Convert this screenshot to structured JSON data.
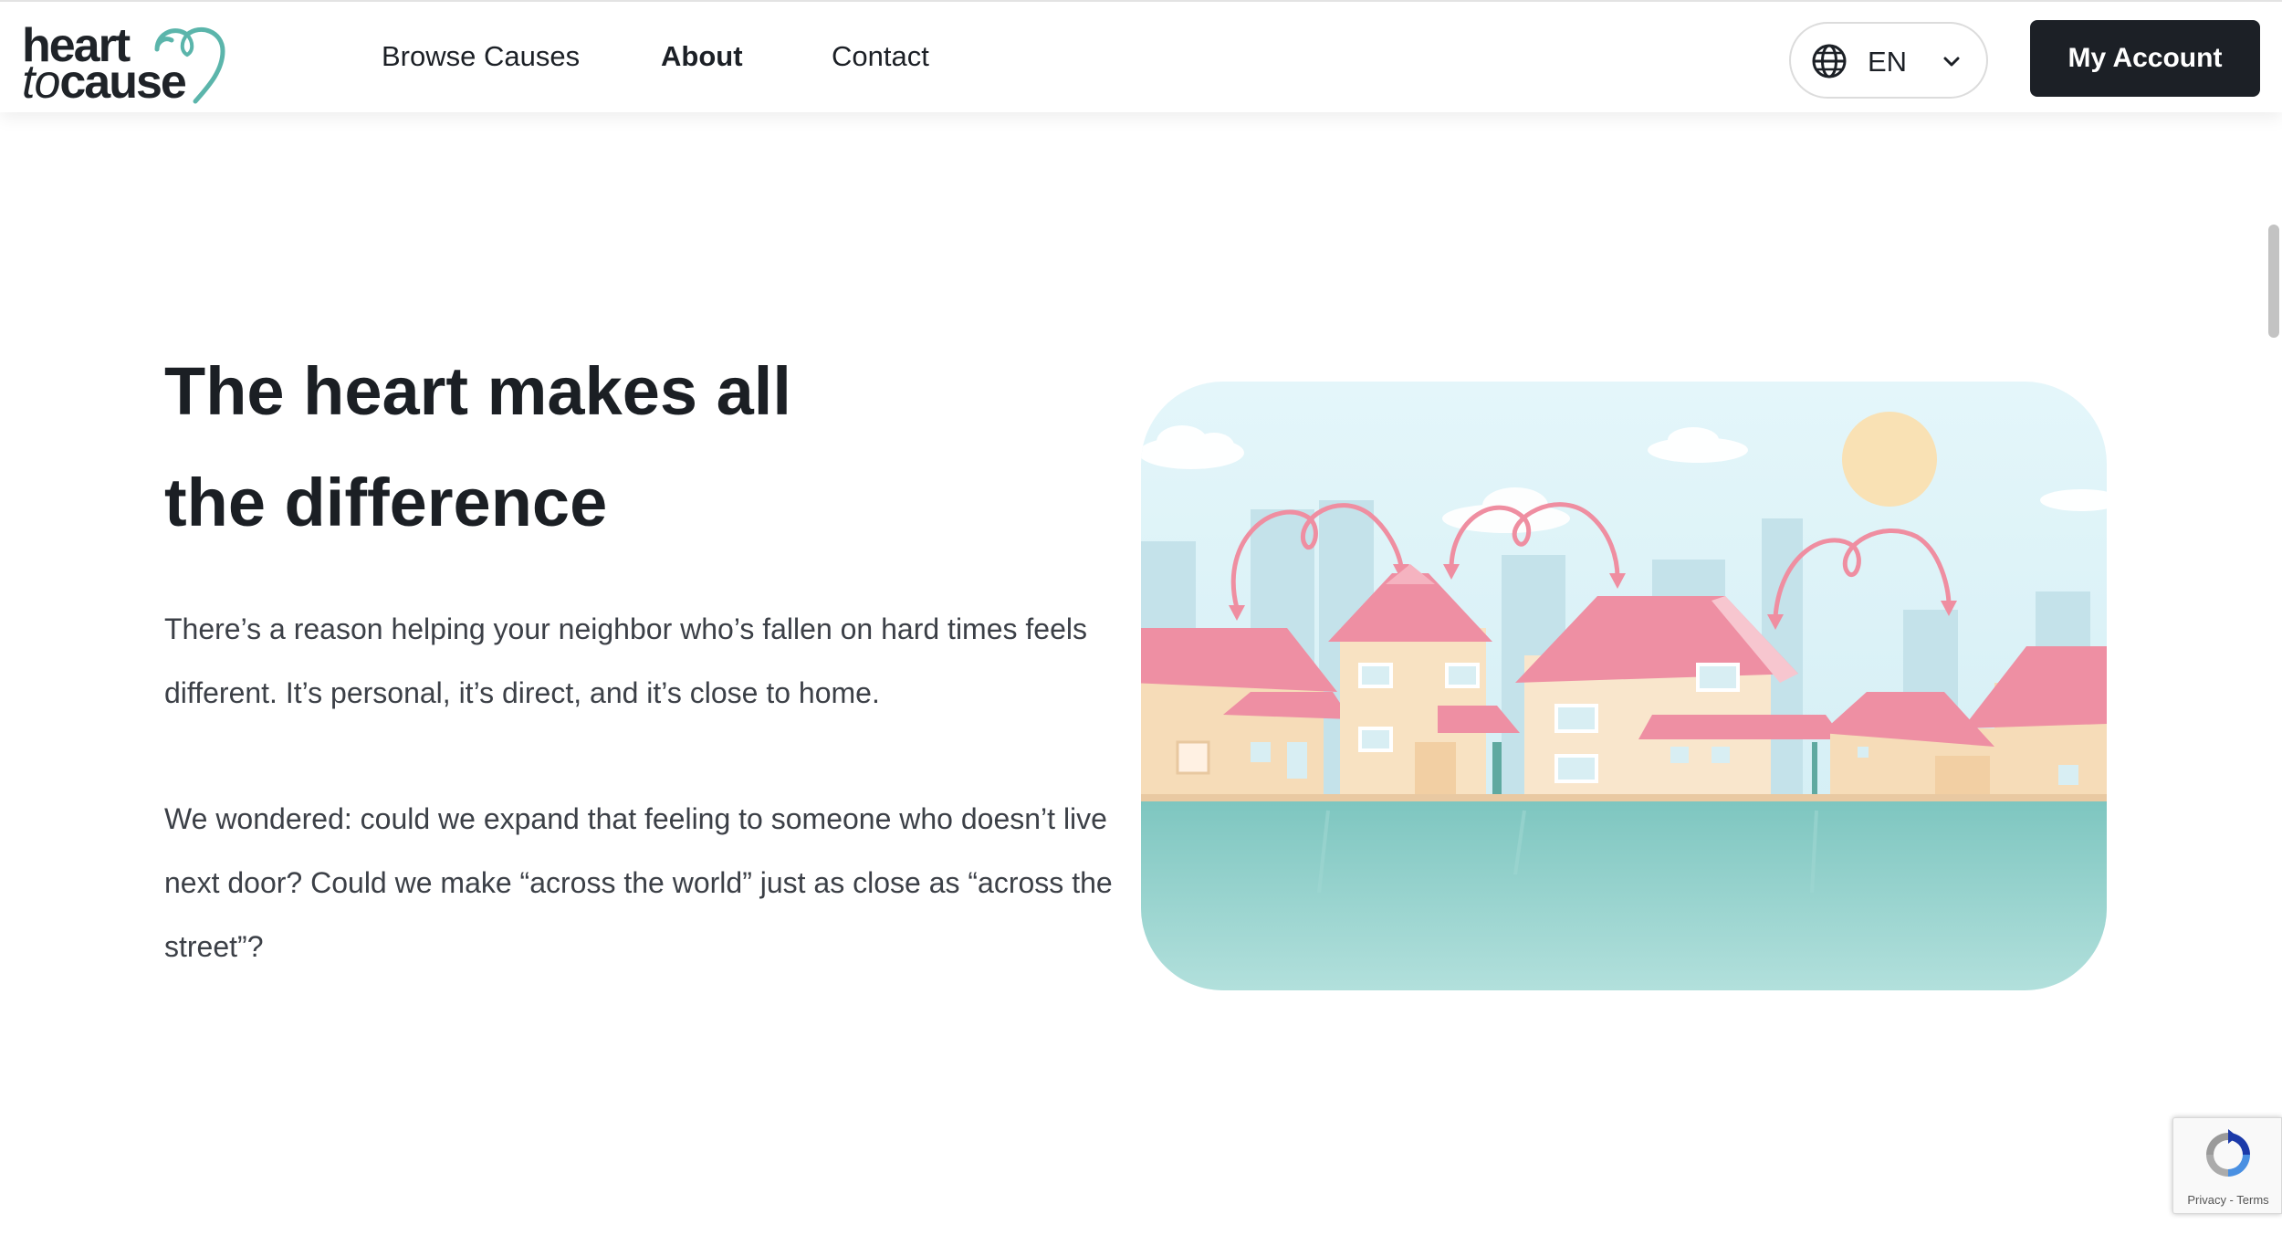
{
  "header": {
    "logo": {
      "line1": "heart",
      "line2_prefix": "to",
      "line2_suffix": "cause"
    },
    "nav": {
      "browse_causes": "Browse Causes",
      "about": "About",
      "contact": "Contact"
    },
    "language": {
      "label": "EN",
      "icon": "globe-icon"
    },
    "account_button": "My Account"
  },
  "main": {
    "headline_line1": "The heart makes all",
    "headline_line2": "the difference",
    "paragraph_1": "There’s a reason helping your neighbor who’s fallen on hard times feels different. It’s personal, it’s direct, and it’s close to home.",
    "paragraph_2": "We wondered: could we expand that feeling to someone who doesn’t live next door? Could we make “across the world” just as close as “across the street”?"
  },
  "recaptcha": {
    "links": "Privacy - Terms"
  },
  "colors": {
    "brand_teal": "#5bb5ab",
    "button_dark": "#1c2026",
    "roof_pink": "#ee8fa3",
    "house_cream": "#f6dcb8",
    "sky": "#dff4f8",
    "ground_teal": "#84cbc5"
  }
}
